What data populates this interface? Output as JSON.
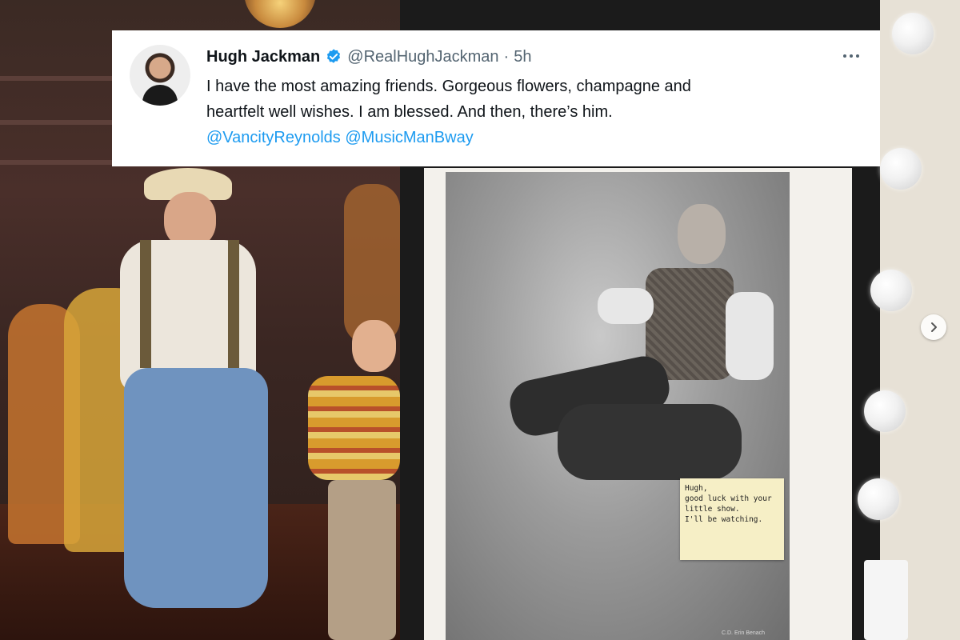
{
  "tweet": {
    "display_name": "Hugh Jackman",
    "handle": "@RealHughJackman",
    "separator": "·",
    "timestamp": "5h",
    "text_line1": "I have the most amazing friends. Gorgeous flowers, champagne and",
    "text_line2": "heartfelt well wishes. I am blessed. And then, there’s him.",
    "mentions": [
      "@VancityReynolds",
      "@MusicManBway"
    ],
    "verified_icon": "verified-badge-icon",
    "more_icon": "more-horizontal-icon",
    "accent_color": "#1d9bf0"
  },
  "sticky_note": {
    "text": "Hugh,\ngood luck with your\nlittle show.\nI'll be watching."
  },
  "poster": {
    "credit": "C.D. Erin Benach"
  },
  "carousel": {
    "next_icon": "chevron-right-icon"
  }
}
